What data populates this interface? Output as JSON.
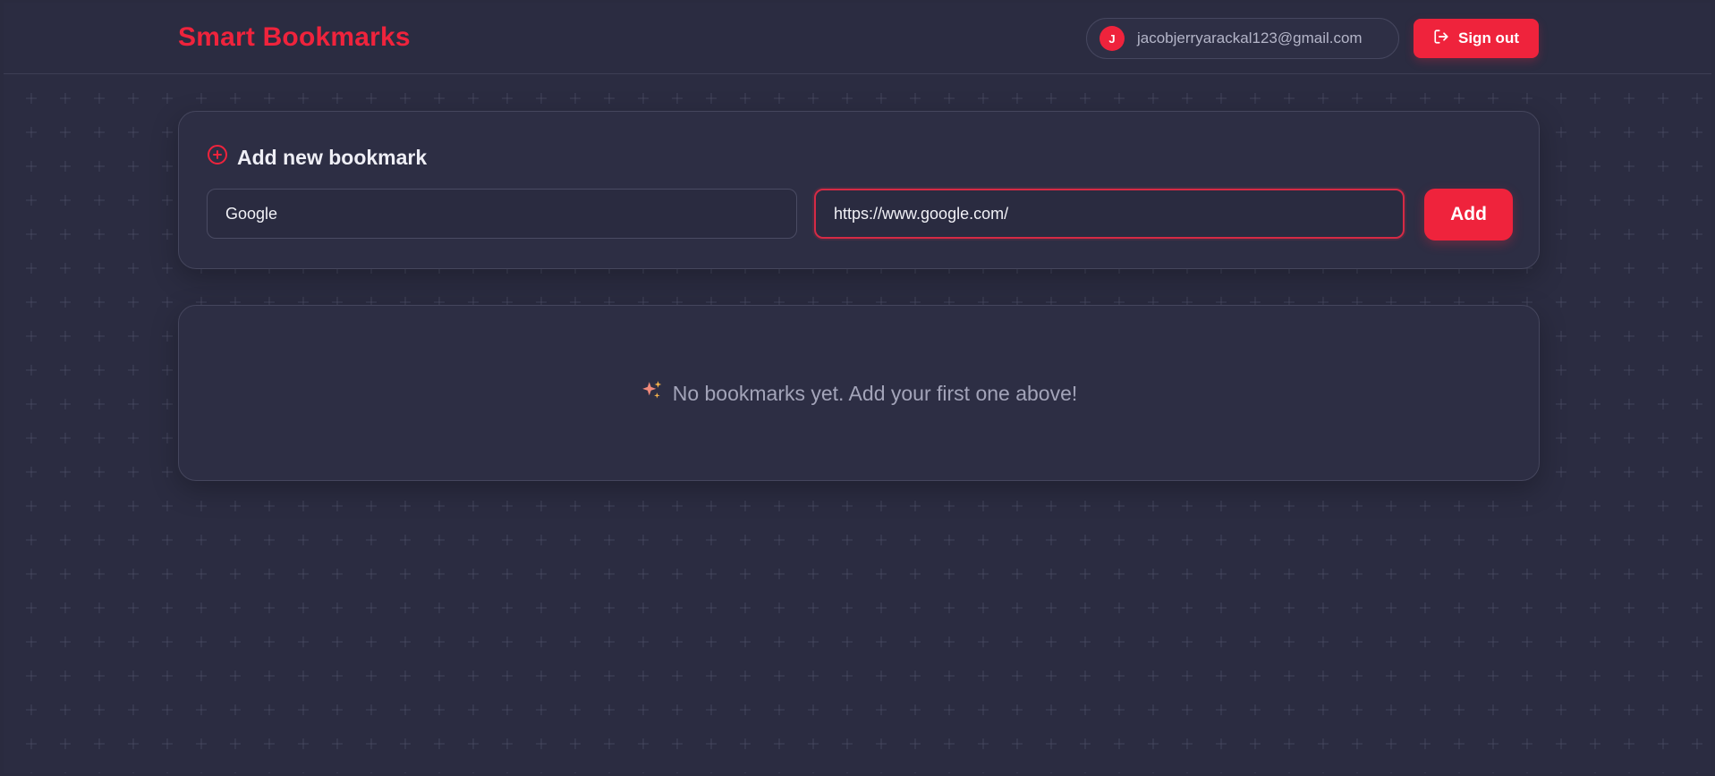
{
  "header": {
    "brand": "Smart Bookmarks",
    "user": {
      "avatar_initial": "J",
      "email": "jacobjerryarackal123@gmail.com"
    },
    "signout_label": "Sign out"
  },
  "add_card": {
    "title": "Add new bookmark",
    "name_input": {
      "value": "Google"
    },
    "url_input": {
      "value": "https://www.google.com/"
    },
    "add_label": "Add"
  },
  "empty_state": {
    "message": "No bookmarks yet. Add your first one above!"
  },
  "colors": {
    "accent": "#ef233c",
    "background": "#2b2c41",
    "card": "#2d2e44"
  }
}
